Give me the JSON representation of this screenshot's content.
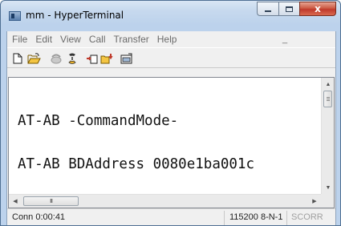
{
  "window": {
    "title": "mm - HyperTerminal",
    "close_glyph": "x"
  },
  "menu": {
    "items": [
      "File",
      "Edit",
      "View",
      "Call",
      "Transfer",
      "Help"
    ],
    "trailing": "_"
  },
  "toolbar": {
    "icons": [
      "new-file-icon",
      "open-folder-icon",
      "phone-icon",
      "disconnect-icon",
      "send-icon",
      "receive-icon",
      "properties-icon"
    ]
  },
  "terminal": {
    "lines": [
      "AT-AB -CommandMode-",
      "AT-AB BDAddress 0080e1ba001c"
    ],
    "hscroll_grip": "III"
  },
  "status": {
    "connection": "Conn 0:00:41",
    "port_settings": "115200 8-N-1",
    "scroll": "SCORR"
  },
  "colors": {
    "title_bar": "#bcd2ec",
    "close_button": "#c0392b",
    "terminal_bg": "#ffffff",
    "chrome": "#f0f0f0"
  }
}
